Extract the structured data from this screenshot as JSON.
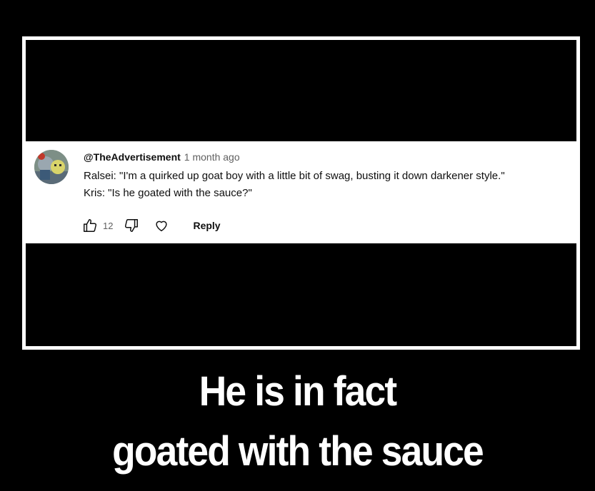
{
  "comment": {
    "author": "@TheAdvertisement",
    "time": "1 month ago",
    "lines": [
      "Ralsei: \"I'm a quirked up goat boy with a little bit of swag, busting it down darkener style.\"",
      "Kris: \"Is he goated with the sauce?\""
    ],
    "like_count": "12",
    "reply_label": "Reply"
  },
  "caption": {
    "line1": "He is in fact",
    "line2": "goated with the sauce"
  },
  "icons": {
    "like": "thumbs-up-icon",
    "dislike": "thumbs-down-icon",
    "heart": "heart-icon"
  },
  "colors": {
    "background": "#000000",
    "frame": "#ffffff",
    "text_primary": "#0f0f0f",
    "text_secondary": "#606060"
  }
}
